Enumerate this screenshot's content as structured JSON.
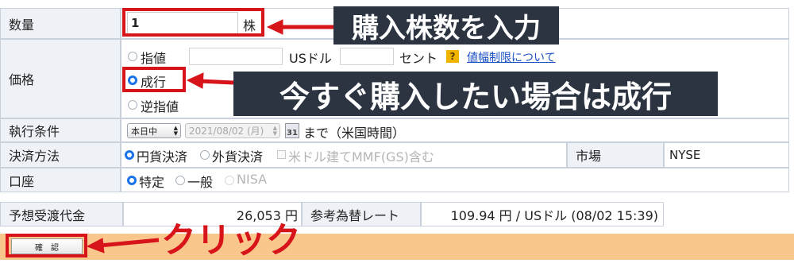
{
  "form": {
    "quantity": {
      "label": "数量",
      "value": "1",
      "unit": "株"
    },
    "price": {
      "label": "価格",
      "options": {
        "limit": "指値",
        "market": "成行",
        "stop": "逆指値"
      },
      "currency_label": "USドル",
      "cents_label": "セント",
      "help_icon_text": "?",
      "help_link": "値幅制限について"
    },
    "execution": {
      "label": "執行条件",
      "term_select": "本日中",
      "date_select": "2021/08/02 (月)",
      "calendar_icon_text": "31",
      "until_text": "まで（米国時間）"
    },
    "settlement": {
      "label": "決済方法",
      "options": {
        "yen": "円貨決済",
        "foreign": "外貨決済"
      },
      "mmf_label": "米ドル建てMMF(GS)含む",
      "market_label": "市場",
      "market_value": "NYSE"
    },
    "account": {
      "label": "口座",
      "options": {
        "specific": "特定",
        "general": "一般",
        "nisa": "NISA"
      }
    },
    "estimate": {
      "label": "予想受渡代金",
      "value": "26,053 円",
      "fx_label": "参考為替レート",
      "fx_value": "109.94 円 / USドル (08/02 15:39)"
    },
    "confirm_button": "確　認"
  },
  "annotations": {
    "quantity_note": "購入株数を入力",
    "market_note": "今すぐ購入したい場合は成行",
    "click_note": "クリック"
  },
  "colors": {
    "accent_red": "#d8141b",
    "label_bg": "#eef2f7",
    "callout_bg": "#2b3440",
    "confirm_bar": "#f9c78c",
    "radio_blue": "#1a73e8",
    "link_blue": "#1a4fc4"
  }
}
